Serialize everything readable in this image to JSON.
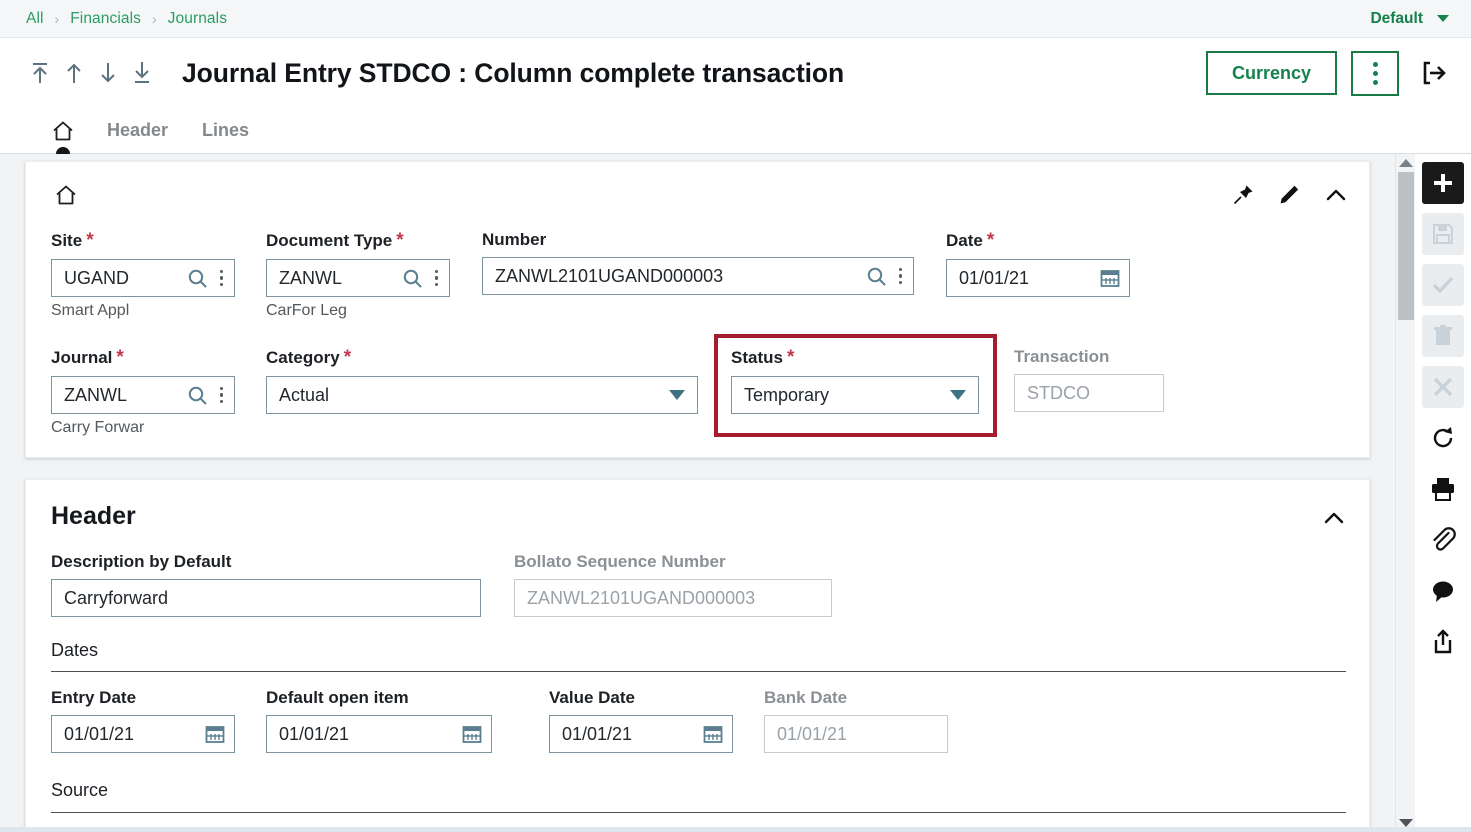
{
  "breadcrumb": {
    "items": [
      "All",
      "Financials",
      "Journals"
    ],
    "separator": "›",
    "profile_label": "Default"
  },
  "title_bar": {
    "title": "Journal Entry STDCO : Column complete transaction",
    "nav_icons": [
      "first-record-icon",
      "previous-record-icon",
      "next-record-icon",
      "last-record-icon"
    ],
    "currency_button": "Currency",
    "kebab_icon": "more-options-icon",
    "exit_icon": "exit-icon"
  },
  "tabs": {
    "home_icon": "home-icon",
    "items": [
      {
        "label": "Header",
        "active": false
      },
      {
        "label": "Lines",
        "active": false
      }
    ],
    "active_index": -1
  },
  "card_top": {
    "home_icon": "home-icon",
    "actions": [
      "pin-icon",
      "edit-pencil-icon",
      "chevron-up-icon"
    ],
    "fields": {
      "site": {
        "label": "Site",
        "required": true,
        "value": "UGAND",
        "hint": "Smart Appl",
        "icons": [
          "search-icon",
          "more-options-icon"
        ]
      },
      "document_type": {
        "label": "Document Type",
        "required": true,
        "value": "ZANWL",
        "hint": "CarFor Leg",
        "icons": [
          "search-icon",
          "more-options-icon"
        ]
      },
      "number": {
        "label": "Number",
        "required": false,
        "value": "ZANWL2101UGAND000003",
        "icons": [
          "search-icon",
          "more-options-icon"
        ]
      },
      "date": {
        "label": "Date",
        "required": true,
        "value": "01/01/21",
        "icons": [
          "calendar-icon"
        ]
      },
      "journal": {
        "label": "Journal",
        "required": true,
        "value": "ZANWL",
        "hint": "Carry Forwar",
        "icons": [
          "search-icon",
          "more-options-icon"
        ]
      },
      "category": {
        "label": "Category",
        "required": true,
        "value": "Actual",
        "icons": [
          "chevron-down-icon"
        ]
      },
      "status": {
        "label": "Status",
        "required": true,
        "value": "Temporary",
        "icons": [
          "chevron-down-icon"
        ],
        "highlighted": true,
        "highlight_color": "#a51c2c"
      },
      "transaction": {
        "label": "Transaction",
        "required": false,
        "value": "STDCO",
        "disabled": true,
        "icons": []
      }
    }
  },
  "card_header": {
    "title": "Header",
    "collapse_icon": "chevron-up-icon",
    "description_by_default": {
      "label": "Description by Default",
      "value": "Carryforward"
    },
    "bollato_sequence_number": {
      "label": "Bollato Sequence Number",
      "value": "ZANWL2101UGAND000003",
      "disabled": true
    },
    "dates_group_label": "Dates",
    "dates": [
      {
        "label": "Entry Date",
        "value": "01/01/21",
        "disabled": false,
        "icon": "calendar-icon"
      },
      {
        "label": "Default open item",
        "value": "01/01/21",
        "disabled": false,
        "icon": "calendar-icon"
      },
      {
        "label": "Value Date",
        "value": "01/01/21",
        "disabled": false,
        "icon": "calendar-icon"
      },
      {
        "label": "Bank Date",
        "value": "01/01/21",
        "disabled": true,
        "icon": ""
      }
    ],
    "source_group_label": "Source"
  },
  "right_toolbar": [
    {
      "name": "add-new-icon",
      "state": "primary"
    },
    {
      "name": "save-icon",
      "state": "disabled"
    },
    {
      "name": "confirm-check-icon",
      "state": "disabled"
    },
    {
      "name": "delete-trash-icon",
      "state": "disabled"
    },
    {
      "name": "cancel-close-icon",
      "state": "disabled"
    },
    {
      "name": "refresh-icon",
      "state": "normal"
    },
    {
      "name": "print-icon",
      "state": "normal"
    },
    {
      "name": "attachment-paperclip-icon",
      "state": "normal"
    },
    {
      "name": "comment-icon",
      "state": "normal"
    },
    {
      "name": "share-export-icon",
      "state": "normal"
    }
  ],
  "scrollbar": {
    "up_arrow": "scroll-up-arrow",
    "down_arrow": "scroll-down-arrow"
  },
  "colors": {
    "accent_green": "#14824a",
    "breadcrumb_link": "#2a9d62",
    "required_red": "#c0394b",
    "highlight_red": "#a51c2c",
    "field_border": "#7e949f",
    "page_bg": "#f1f3f5"
  }
}
